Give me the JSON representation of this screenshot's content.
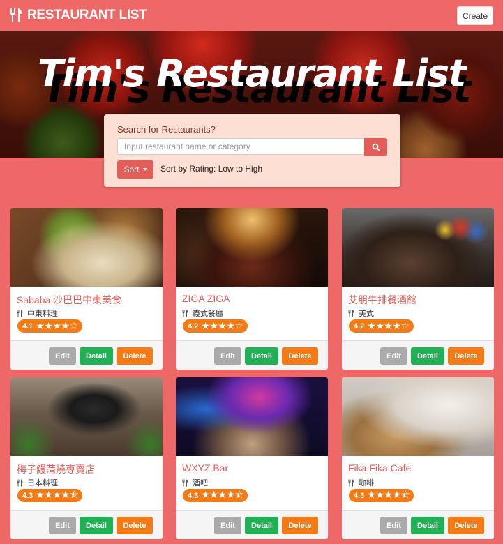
{
  "navbar": {
    "brand": "RESTAURANT LIST",
    "create_label": "Create"
  },
  "hero": {
    "title": "Tim's Restaurant List"
  },
  "search": {
    "label": "Search for Restaurants?",
    "placeholder": "Input restaurant name or category",
    "sort_label": "Sort",
    "sort_status": "Sort by Rating: Low to High"
  },
  "buttons": {
    "edit": "Edit",
    "detail": "Detail",
    "delete": "Delete"
  },
  "restaurants": [
    {
      "name": "Sababa 沙巴巴中東美食",
      "category": "中東料理",
      "rating": "4.1",
      "stars": "★★★★☆"
    },
    {
      "name": "ZIGA ZIGA",
      "category": "義式餐廳",
      "rating": "4.2",
      "stars": "★★★★☆"
    },
    {
      "name": "艾朋牛排餐酒館",
      "category": "美式",
      "rating": "4.2",
      "stars": "★★★★☆"
    },
    {
      "name": "梅子鰻蒲燒專賣店",
      "category": "日本料理",
      "rating": "4.3",
      "stars": "★★★★⯪"
    },
    {
      "name": "WXYZ Bar",
      "category": "酒吧",
      "rating": "4.3",
      "stars": "★★★★⯪"
    },
    {
      "name": "Fika Fika Cafe",
      "category": "咖啡",
      "rating": "4.3",
      "stars": "★★★★⯪"
    }
  ],
  "colors": {
    "brand": "#ee6868",
    "accent": "#e35d59",
    "orange": "#f37a14",
    "green": "#1fb154",
    "grey": "#aaaaaa",
    "panel": "#fde0d3"
  }
}
